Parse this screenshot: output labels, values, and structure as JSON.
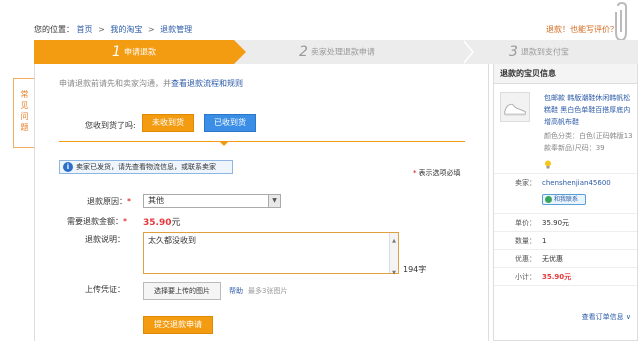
{
  "breadcrumb": {
    "prefix": "您的位置：",
    "items": [
      "首页",
      "我的淘宝",
      "退款管理"
    ]
  },
  "topright": {
    "text": "退款！也能写评价？"
  },
  "steps": [
    {
      "num": "1",
      "label": "申请退款",
      "active": true
    },
    {
      "num": "2",
      "label": "卖家处理退款申请",
      "active": false
    },
    {
      "num": "3",
      "label": "退款到支付宝",
      "active": false
    }
  ],
  "faq": {
    "label": "常见问题"
  },
  "form": {
    "notice_prefix": "申请退款前请先和卖家沟通，并",
    "notice_link": "查看退款流程和规则",
    "received_question": "您收到货了吗:",
    "not_received_btn": "未收到货",
    "received_btn": "已收到货",
    "info_text": "卖家已发货，请先查看物流信息，或联系卖家",
    "required_note": "表示选项必填",
    "reason_label": "退款原因：",
    "reason_value": "其他",
    "amount_label": "需要退款金额：",
    "amount_value": "35.90",
    "amount_unit": "元",
    "desc_label": "退款说明：",
    "desc_value": "太久都没收到",
    "char_count": "194字",
    "upload_label": "上传凭证：",
    "upload_btn": "选择要上传的图片",
    "help_link": "帮助",
    "upload_hint": "最多3张图片",
    "submit_btn": "提交退款申请"
  },
  "sidebar": {
    "title": "退款的宝贝信息",
    "product_name": "包邮款 韩版潮鞋休闲韩帆松糕鞋 黑白色单鞋百搭厚底内增高帆布鞋",
    "product_attr": "颜色分类：白色(正码韩版13款奉新品)尺码：39",
    "seller_label": "卖家：",
    "seller_name": "chenshenjian45600",
    "contact_label": "和我联系",
    "unit_price_label": "单价：",
    "unit_price": "35.90元",
    "qty_label": "数量：",
    "qty": "1",
    "discount_label": "优惠：",
    "discount": "无优惠",
    "subtotal_label": "小计：",
    "subtotal": "35.90元",
    "order_link": "查看订单信息 ∨"
  },
  "colors": {
    "accent": "#f39c12",
    "link": "#2b5aa8",
    "price": "#e4393c",
    "blue_button": "#3a8ee6"
  }
}
